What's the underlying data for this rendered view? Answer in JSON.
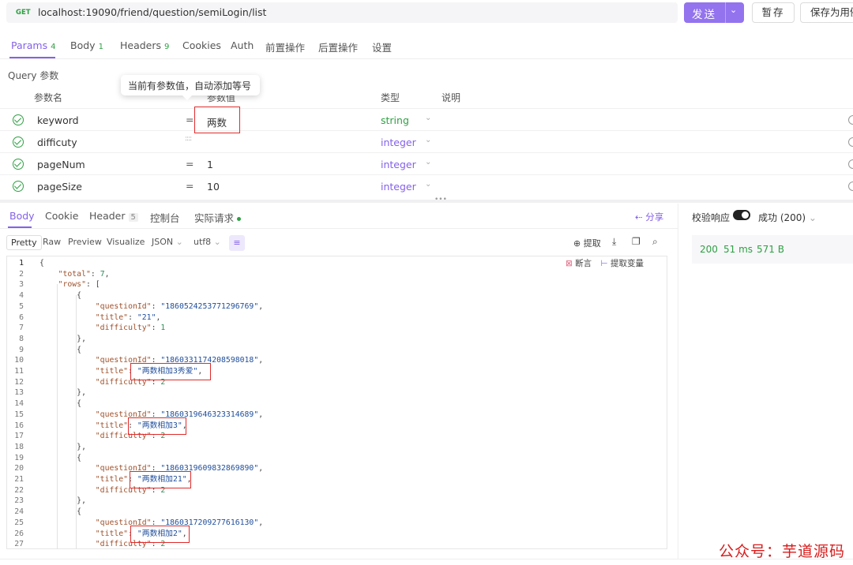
{
  "request": {
    "method": "GET",
    "url": "localhost:19090/friend/question/semiLogin/list",
    "send_label": "发送",
    "save_temp_label": "暂存",
    "save_case_label": "保存为用例"
  },
  "request_tabs": [
    {
      "label": "Params",
      "count": "4"
    },
    {
      "label": "Body",
      "count": "1"
    },
    {
      "label": "Headers",
      "count": "9"
    },
    {
      "label": "Cookies",
      "count": ""
    },
    {
      "label": "Auth",
      "count": ""
    },
    {
      "label": "前置操作",
      "count": ""
    },
    {
      "label": "后置操作",
      "count": ""
    },
    {
      "label": "设置",
      "count": ""
    }
  ],
  "query": {
    "title": "Query 参数",
    "tooltip": "当前有参数值，自动添加等号",
    "headers": {
      "name": "参数名",
      "value": "参数值",
      "type": "类型",
      "desc": "说明"
    },
    "params": [
      {
        "name": "keyword",
        "eq": "=",
        "value": "两数",
        "type": "string"
      },
      {
        "name": "difficuty",
        "eq": "",
        "value": "",
        "type": "integer"
      },
      {
        "name": "pageNum",
        "eq": "=",
        "value": "1",
        "type": "integer"
      },
      {
        "name": "pageSize",
        "eq": "=",
        "value": "10",
        "type": "integer"
      }
    ]
  },
  "response_tabs": [
    {
      "label": "Body",
      "count": ""
    },
    {
      "label": "Cookie",
      "count": ""
    },
    {
      "label": "Header",
      "count": "5"
    },
    {
      "label": "控制台",
      "count": ""
    },
    {
      "label": "实际请求",
      "count": ""
    }
  ],
  "share_label": "分享",
  "format_bar": {
    "pretty": "Pretty",
    "raw": "Raw",
    "preview": "Preview",
    "visualize": "Visualize",
    "format": "JSON",
    "encoding": "utf8",
    "extract": "提取",
    "assert": "断言",
    "extract_var": "提取变量"
  },
  "verify": {
    "label": "校验响应",
    "status": "成功 (200)"
  },
  "stats": {
    "code": "200",
    "time": "51 ms",
    "size": "571 B"
  },
  "code_lines": [
    "{",
    "    \"total\": 7,",
    "    \"rows\": [",
    "        {",
    "            \"questionId\": \"1860524253771296769\",",
    "            \"title\": \"21\",",
    "            \"difficulty\": 1",
    "        },",
    "        {",
    "            \"questionId\": \"1860331174208598018\",",
    "            \"title\": \"两数相加3秀爱\",",
    "            \"difficulty\": 2",
    "        },",
    "        {",
    "            \"questionId\": \"1860319646323314689\",",
    "            \"title\": \"两数相加3\",",
    "            \"difficulty\": 2",
    "        },",
    "        {",
    "            \"questionId\": \"1860319609832869890\",",
    "            \"title\": \"两数相加21\",",
    "            \"difficulty\": 2",
    "        },",
    "        {",
    "            \"questionId\": \"1860317209277616130\",",
    "            \"title\": \"两数相加2\",",
    "            \"difficulty\": 2"
  ],
  "watermark": "公众号：芋道源码"
}
